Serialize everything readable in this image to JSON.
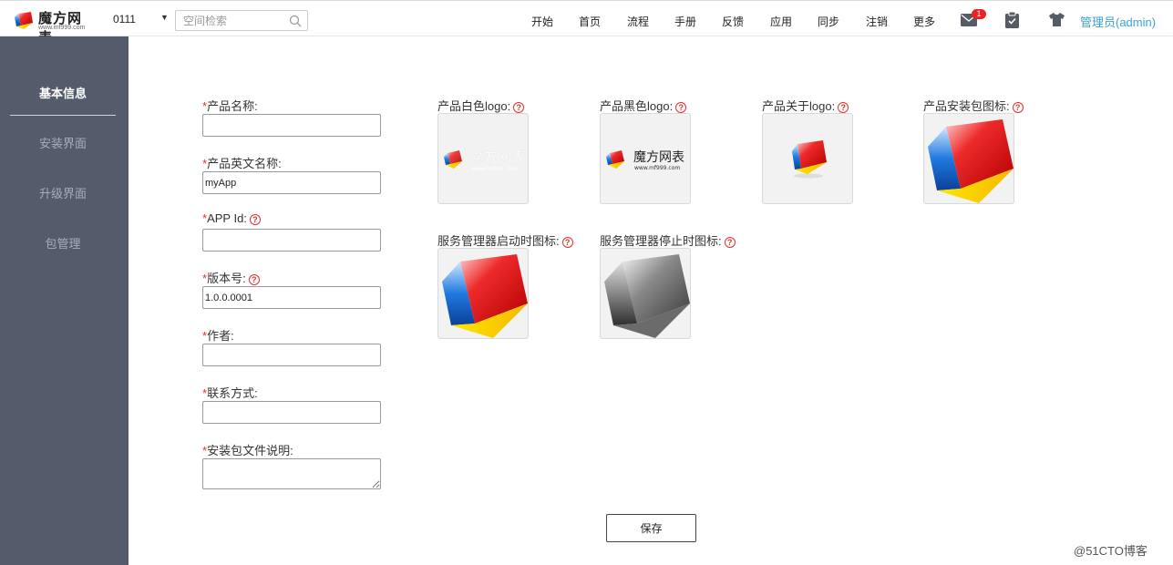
{
  "topbar": {
    "logo_text": "魔方网表",
    "logo_sub": "www.mf999.com",
    "space_code": "0111",
    "search_placeholder": "空间检索",
    "nav": [
      "开始",
      "首页",
      "流程",
      "手册",
      "反馈",
      "应用",
      "同步",
      "注销",
      "更多"
    ],
    "mail_count": "1",
    "user": "管理员(admin)",
    "user_color": "#3aa3d8"
  },
  "sidebar": {
    "items": [
      "基本信息",
      "安装界面",
      "升级界面",
      "包管理"
    ],
    "active": "基本信息"
  },
  "form": {
    "product_name_label": "产品名称:",
    "product_en_name_label": "产品英文名称:",
    "product_en_name_value": "myApp",
    "app_id_label": "APP Id:",
    "version_label": "版本号:",
    "version_value": "1.0.0.0001",
    "author_label": "作者:",
    "contact_label": "联系方式:",
    "package_desc_label": "安装包文件说明:",
    "required_mark": "*",
    "help_mark": "?"
  },
  "images": {
    "white_logo_label": "产品白色logo:",
    "black_logo_label": "产品黑色logo:",
    "about_logo_label": "产品关于logo:",
    "package_icon_label": "产品安装包图标:",
    "service_start_label": "服务管理器启动时图标:",
    "service_stop_label": "服务管理器停止时图标:",
    "logo_text": "魔方网表",
    "logo_sub": "www.mf999.com"
  },
  "save_label": "保存",
  "watermark": "@51CTO博客",
  "colors": {
    "sidebar_bg": "#545c6b",
    "required": "#e0312e",
    "accent": "#3aa3d8"
  }
}
